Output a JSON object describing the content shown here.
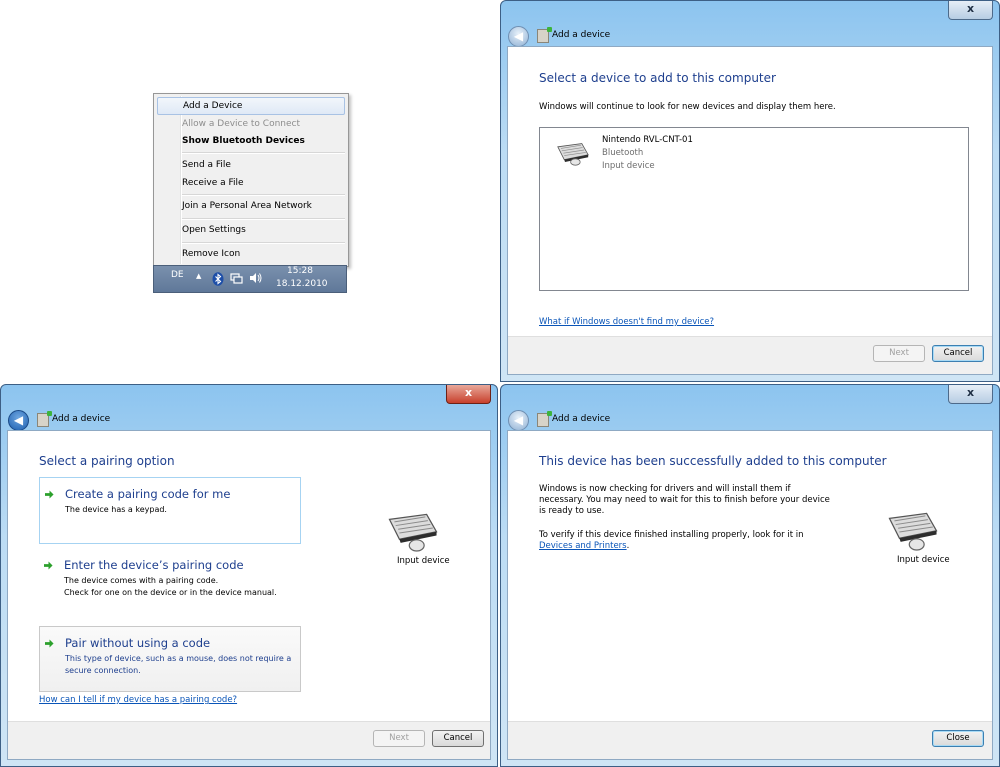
{
  "context_menu": {
    "items": [
      {
        "label": "Add a Device"
      },
      {
        "label": "Allow a Device to Connect"
      },
      {
        "label": "Show Bluetooth Devices"
      },
      {
        "label": "Send a File"
      },
      {
        "label": "Receive a File"
      },
      {
        "label": "Join a Personal Area Network"
      },
      {
        "label": "Open Settings"
      },
      {
        "label": "Remove Icon"
      }
    ]
  },
  "taskbar": {
    "language": "DE",
    "time": "15:28",
    "date": "18.12.2010",
    "icons": [
      "show-hidden-icons-arrow-icon",
      "bluetooth-icon",
      "network-icon",
      "volume-icon"
    ]
  },
  "window1": {
    "close_label": "x",
    "title": "Add a device",
    "heading": "Select a device to add to this computer",
    "subtext": "Windows will continue to look for new devices and display them here.",
    "device": {
      "name": "Nintendo RVL-CNT-01",
      "type": "Bluetooth",
      "category": "Input device"
    },
    "help_link": "What if Windows doesn't find my device?",
    "next_label": "Next",
    "cancel_label": "Cancel"
  },
  "window2": {
    "close_label": "x",
    "title": "Add a device",
    "heading": "Select a pairing option",
    "options": [
      {
        "title": "Create a pairing code for me",
        "desc1": "The device has a keypad.",
        "desc2": ""
      },
      {
        "title": "Enter the device’s pairing code",
        "desc1": "The device comes with a pairing code.",
        "desc2": "Check for one on the device or in the device manual."
      },
      {
        "title": "Pair without using a code",
        "desc1": "This type of device, such as a mouse, does not require a",
        "desc2": "secure connection."
      }
    ],
    "device_label": "Input device",
    "help_link": "How can I tell if my device has a pairing code?",
    "next_label": "Next",
    "cancel_label": "Cancel"
  },
  "window3": {
    "close_label": "x",
    "title": "Add a device",
    "heading": "This device has been successfully added to this computer",
    "para1": [
      "Windows is now checking for drivers and will install them if",
      "necessary. You may need to wait for this to finish before your device",
      "is ready to use."
    ],
    "para2": "To verify if this device finished installing properly, look for it in",
    "link": "Devices and Printers",
    "link_suffix": ".",
    "device_label": "Input device",
    "close_button": "Close"
  },
  "colors": {
    "heading_blue": "#1e3f8e",
    "link_blue": "#0a55b8",
    "close_red": "#c7402c"
  }
}
